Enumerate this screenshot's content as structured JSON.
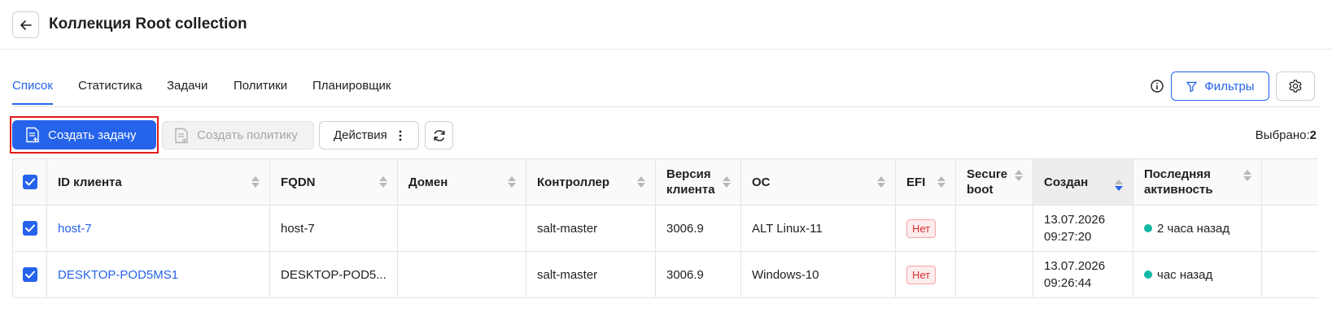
{
  "header": {
    "title": "Коллекция Root collection"
  },
  "tabs": [
    {
      "label": "Список",
      "active": true
    },
    {
      "label": "Статистика",
      "active": false
    },
    {
      "label": "Задачи",
      "active": false
    },
    {
      "label": "Политики",
      "active": false
    },
    {
      "label": "Планировщик",
      "active": false
    }
  ],
  "toolbar": {
    "filters_label": "Фильтры",
    "create_task_label": "Создать задачу",
    "create_policy_label": "Создать политику",
    "actions_label": "Действия",
    "selected_label": "Выбрано:",
    "selected_count": "2"
  },
  "table": {
    "columns": {
      "id": "ID клиента",
      "fqdn": "FQDN",
      "domain": "Домен",
      "controller": "Контроллер",
      "version_1": "Версия",
      "version_2": "клиента",
      "os": "ОС",
      "efi": "EFI",
      "secure_1": "Secure",
      "secure_2": "boot",
      "created": "Создан",
      "last_1": "Последняя",
      "last_2": "активность"
    },
    "rows": [
      {
        "id": "host-7",
        "fqdn": "host-7",
        "domain": "",
        "controller": "salt-master",
        "version": "3006.9",
        "os": "ALT Linux-11",
        "efi": "Нет",
        "secure_boot": "",
        "created_date": "13.07.2026",
        "created_time": "09:27:20",
        "last_activity": "2 часа назад"
      },
      {
        "id": "DESKTOP-POD5MS1",
        "fqdn": "DESKTOP-POD5...",
        "domain": "",
        "controller": "salt-master",
        "version": "3006.9",
        "os": "Windows-10",
        "efi": "Нет",
        "secure_boot": "",
        "created_date": "13.07.2026",
        "created_time": "09:26:44",
        "last_activity": "час назад"
      }
    ]
  },
  "colors": {
    "accent": "#2563eb",
    "highlight": "#e31b1b",
    "status_online": "#14b8a6",
    "badge_no": "#d32f2f"
  }
}
